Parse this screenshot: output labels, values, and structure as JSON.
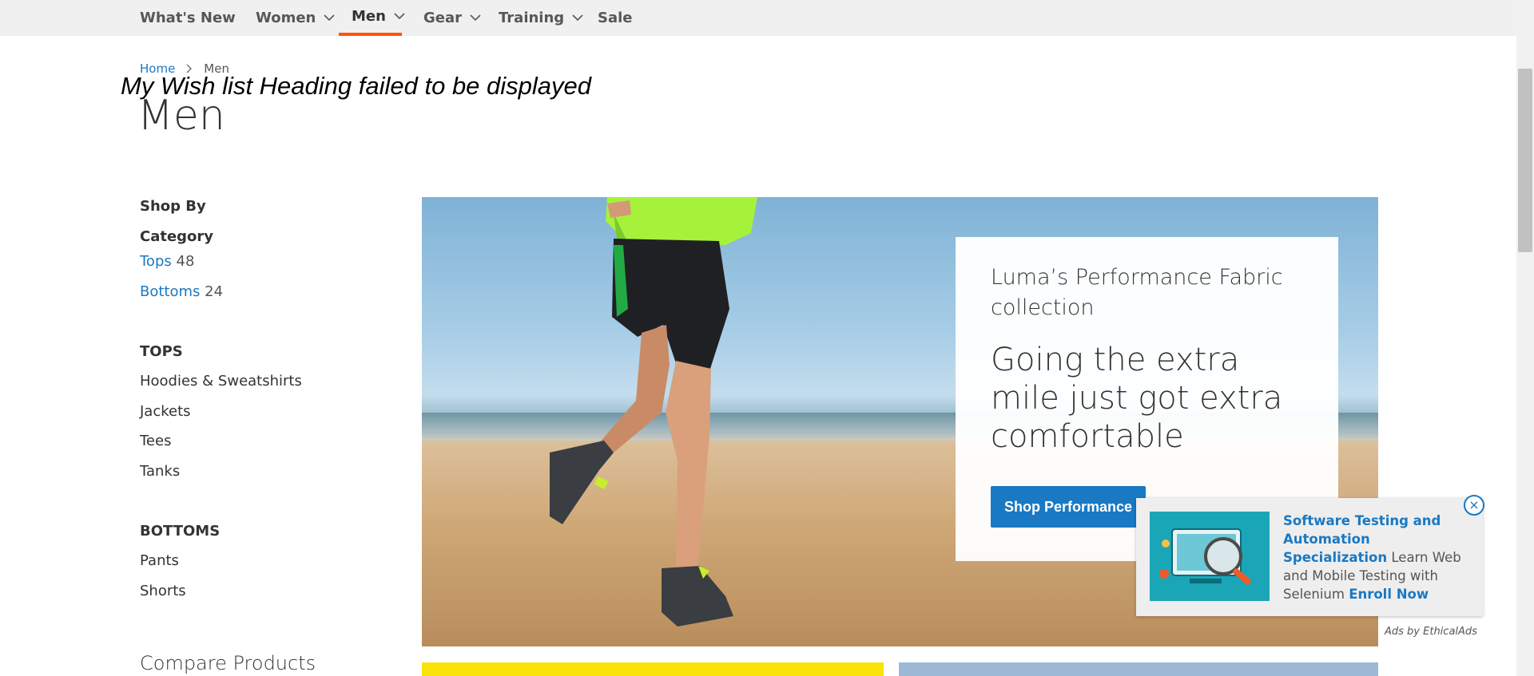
{
  "nav": {
    "items": [
      {
        "label": "What's New",
        "has_menu": false,
        "active": false
      },
      {
        "label": "Women",
        "has_menu": true,
        "active": false
      },
      {
        "label": "Men",
        "has_menu": true,
        "active": true
      },
      {
        "label": "Gear",
        "has_menu": true,
        "active": false
      },
      {
        "label": "Training",
        "has_menu": true,
        "active": false
      },
      {
        "label": "Sale",
        "has_menu": false,
        "active": false
      }
    ],
    "active_color": "#ff5501"
  },
  "breadcrumb": {
    "home": "Home",
    "current": "Men"
  },
  "overlay_message": "My Wish list Heading failed to be displayed",
  "page_title": "Men",
  "sidebar": {
    "shop_by": "Shop By",
    "category": "Category",
    "categories": [
      {
        "label": "Tops",
        "count": "48"
      },
      {
        "label": "Bottoms",
        "count": "24"
      }
    ],
    "tops_title": "TOPS",
    "tops_links": [
      "Hoodies & Sweatshirts",
      "Jackets",
      "Tees",
      "Tanks"
    ],
    "bottoms_title": "BOTTOMS",
    "bottoms_links": [
      "Pants",
      "Shorts"
    ],
    "compare": "Compare Products"
  },
  "hero": {
    "subtitle": "Luma’s Performance Fabric collection",
    "headline": "Going the extra mile just got extra comfortable",
    "button": "Shop Performance"
  },
  "ad": {
    "title": "Software Testing and Automation Specialization",
    "body": "Learn Web and Mobile Testing with Selenium",
    "cta": "Enroll Now",
    "close": "×",
    "credit": "Ads by EthicalAds"
  },
  "colors": {
    "link": "#1979c3",
    "button": "#1979c3",
    "tile_yellow": "#fae30b",
    "tile_blue": "#9db8d4"
  }
}
